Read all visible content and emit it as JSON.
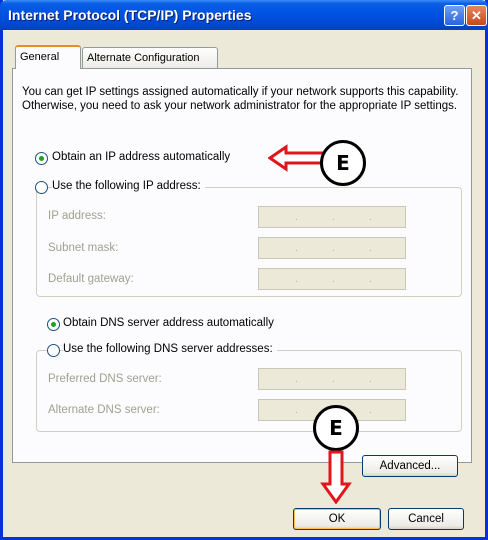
{
  "window": {
    "title": "Internet Protocol (TCP/IP) Properties",
    "help_glyph": "?",
    "close_glyph": "✕"
  },
  "tabs": [
    {
      "label": "General"
    },
    {
      "label": "Alternate Configuration"
    }
  ],
  "intro": "You can get IP settings assigned automatically if your network supports this capability. Otherwise, you need to ask your network administrator for the appropriate IP settings.",
  "ip": {
    "auto_label": "Obtain an IP address automatically",
    "manual_label": "Use the following IP address:",
    "fields": [
      {
        "label": "IP address:"
      },
      {
        "label": "Subnet mask:"
      },
      {
        "label": "Default gateway:"
      }
    ],
    "selected": "auto"
  },
  "dns": {
    "auto_label": "Obtain DNS server address automatically",
    "manual_label": "Use the following DNS server addresses:",
    "fields": [
      {
        "label": "Preferred DNS server:"
      },
      {
        "label": "Alternate DNS server:"
      }
    ],
    "selected": "auto"
  },
  "buttons": {
    "advanced": "Advanced...",
    "ok": "OK",
    "cancel": "Cancel"
  },
  "annotations": [
    {
      "letter": "E"
    },
    {
      "letter": "E"
    }
  ],
  "colors": {
    "title_bar": "#0054e3",
    "annotation_arrow": "#e0161c",
    "dialog_bg": "#ece9d8"
  }
}
